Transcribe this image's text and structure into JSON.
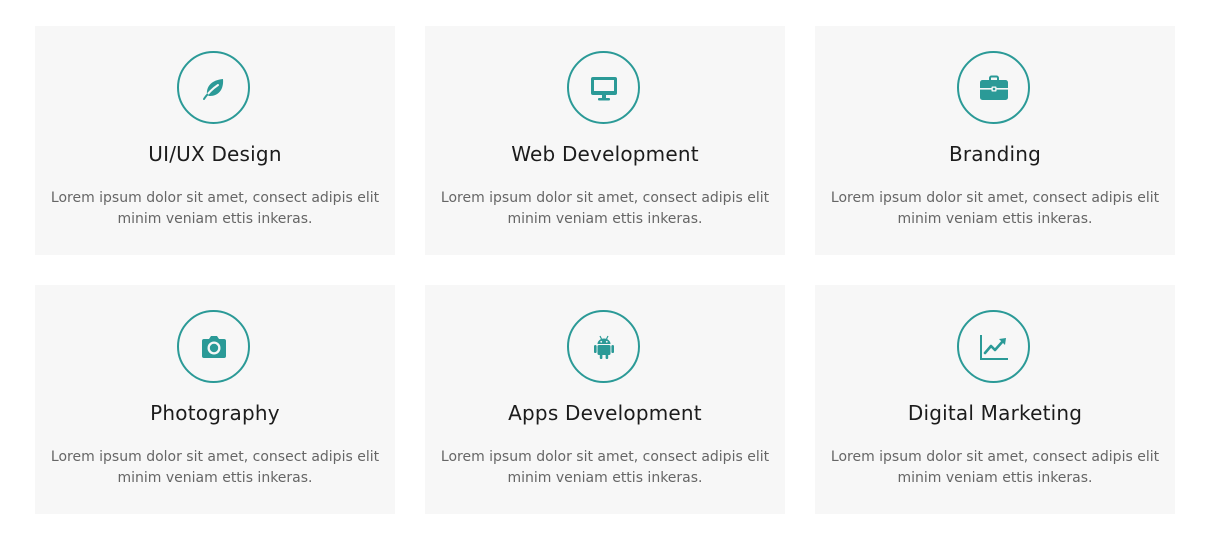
{
  "accent_color": "#2b9a97",
  "card_background": "#f7f7f7",
  "services": [
    {
      "icon": "leaf-icon",
      "title": "UI/UX Design",
      "description": "Lorem ipsum dolor sit amet, consect adipis elit minim veniam ettis inkeras."
    },
    {
      "icon": "desktop-icon",
      "title": "Web Development",
      "description": "Lorem ipsum dolor sit amet, consect adipis elit minim veniam ettis inkeras."
    },
    {
      "icon": "briefcase-icon",
      "title": "Branding",
      "description": "Lorem ipsum dolor sit amet, consect adipis elit minim veniam ettis inkeras."
    },
    {
      "icon": "camera-icon",
      "title": "Photography",
      "description": "Lorem ipsum dolor sit amet, consect adipis elit minim veniam ettis inkeras."
    },
    {
      "icon": "android-icon",
      "title": "Apps Development",
      "description": "Lorem ipsum dolor sit amet, consect adipis elit minim veniam ettis inkeras."
    },
    {
      "icon": "line-chart-icon",
      "title": "Digital Marketing",
      "description": "Lorem ipsum dolor sit amet, consect adipis elit minim veniam ettis inkeras."
    }
  ]
}
